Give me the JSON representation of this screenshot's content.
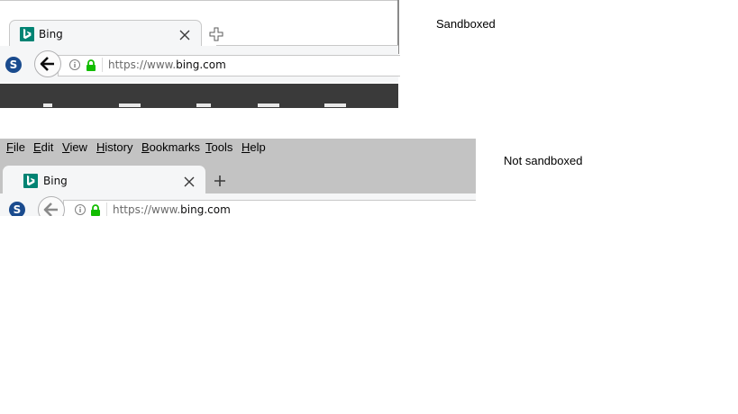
{
  "panels": {
    "sandboxed": {
      "label": "Sandboxed",
      "tab": {
        "title": "Bing"
      },
      "url": {
        "prefix": "https://www.",
        "host": "bing.com"
      }
    },
    "not_sandboxed": {
      "label": "Not sandboxed",
      "menu": [
        {
          "first": "F",
          "rest": "ile"
        },
        {
          "first": "E",
          "rest": "dit"
        },
        {
          "first": "V",
          "rest": "iew"
        },
        {
          "first": "H",
          "rest": "istory"
        },
        {
          "first": "B",
          "rest": "ookmarks"
        },
        {
          "first": "T",
          "rest": "ools"
        },
        {
          "first": "H",
          "rest": "elp"
        }
      ],
      "tab": {
        "title": "Bing"
      },
      "url": {
        "prefix": "https://www.",
        "host": "bing.com"
      }
    }
  },
  "colors": {
    "bing_brand": "#008373",
    "secure_lock": "#12bc00",
    "menubar_bg": "#c3c3c3",
    "dark_toolbar": "#3a3a3a"
  },
  "icons": [
    "bing-logo-icon",
    "close-icon",
    "new-tab-icon",
    "sync-icon",
    "back-arrow-icon",
    "info-icon",
    "lock-icon"
  ]
}
